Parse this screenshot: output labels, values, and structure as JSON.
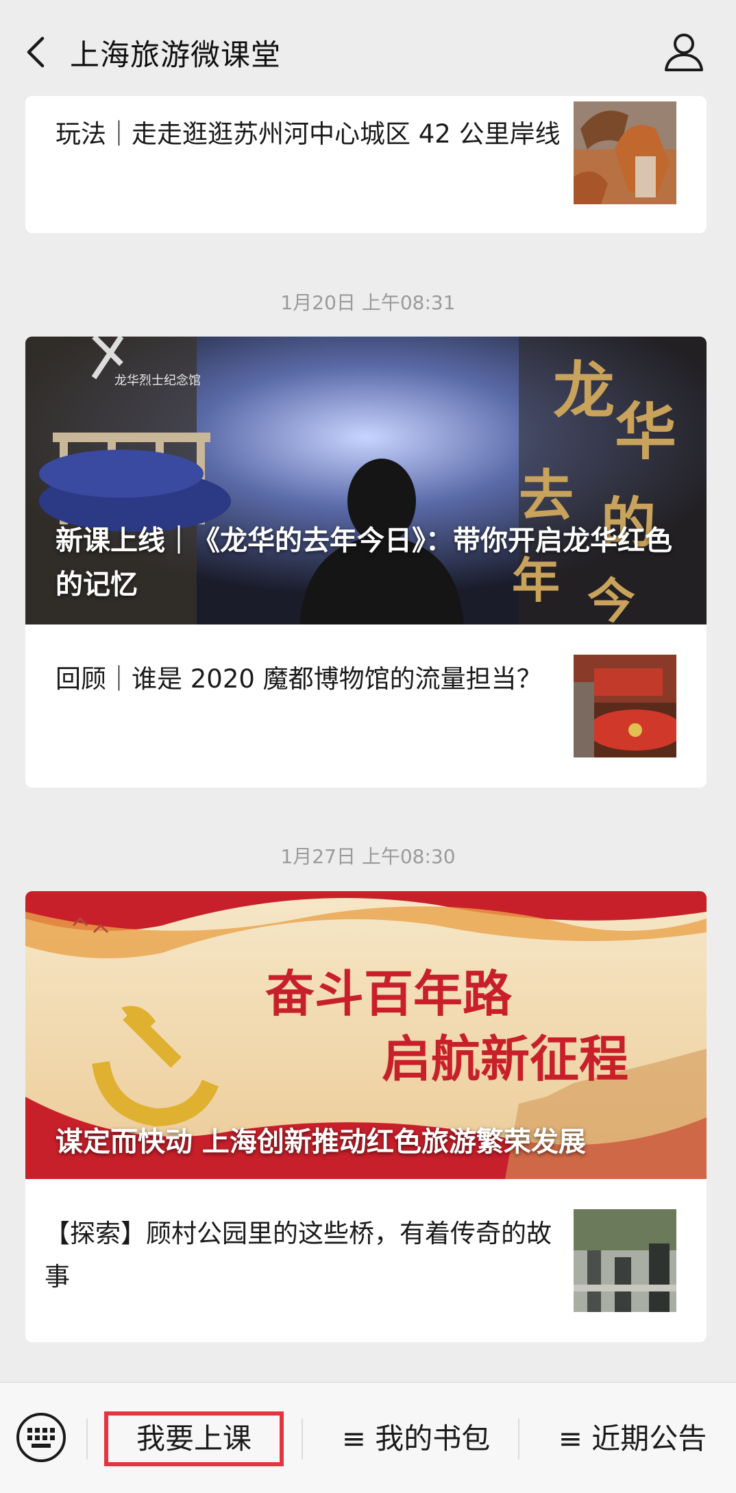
{
  "header": {
    "title": "上海旅游微课堂",
    "back_icon": "chevron-left-icon",
    "profile_icon": "person-icon"
  },
  "cards": {
    "c1": {
      "item_title": "玩法｜走走逛逛苏州河中心城区 42 公里岸线"
    },
    "c2": {
      "timestamp": "1月20日 上午08:31",
      "hero_title": "新课上线｜《龙华的去年今日》：带你开启龙华红色的记忆",
      "hero_caption": "龙华烈士纪念馆",
      "hero_art_text": "龙华去年的今",
      "item_title": "回顾｜谁是 2020 魔都博物馆的流量担当？"
    },
    "c3": {
      "timestamp": "1月27日 上午08:30",
      "hero_title": "谋定而快动 上海创新推动红色旅游繁荣发展",
      "hero_art_line1": "奋斗百年路",
      "hero_art_line2": "启航新征程",
      "item_title": "【探索】顾村公园里的这些桥，有着传奇的故事"
    }
  },
  "bottom_menu": {
    "keyboard_icon": "keyboard-icon",
    "item1": "我要上课",
    "item2": "≡ 我的书包",
    "item3": "≡ 近期公告"
  },
  "colors": {
    "highlight": "#e33440",
    "background": "#ededed"
  }
}
